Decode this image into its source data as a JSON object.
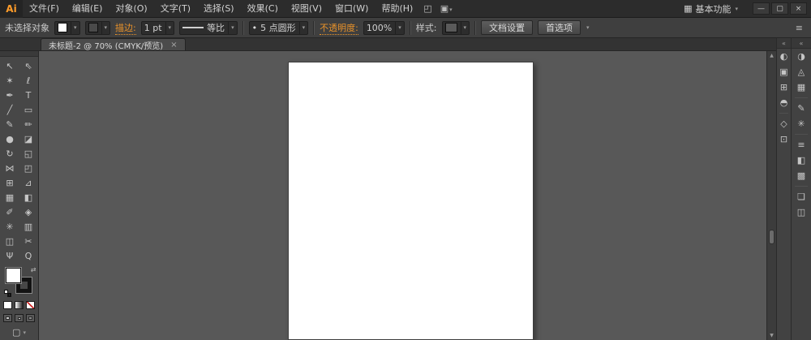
{
  "colors": {
    "accent_orange": "#e8922a",
    "logo_orange": "#ff9c2a",
    "canvas_gray": "#585858",
    "artboard_white": "#ffffff",
    "panel_gray": "#424242"
  },
  "menu_bar": {
    "logo": "Ai",
    "items": [
      "文件(F)",
      "编辑(E)",
      "对象(O)",
      "文字(T)",
      "选择(S)",
      "效果(C)",
      "视图(V)",
      "窗口(W)",
      "帮助(H)"
    ],
    "bridge_icon": "◰",
    "arrange_documents_icon": "▣",
    "arrange_documents_arrow": "▾",
    "workspace_icon": "▦",
    "workspace": "基本功能",
    "workspace_arrow": "▾",
    "minimize_glyph": "—",
    "restore_glyph": "▢",
    "close_glyph": "×"
  },
  "control_bar": {
    "selection_status": "未选择对象",
    "fill_arrow": "▾",
    "stroke_arrow": "▾",
    "stroke_label": "描边:",
    "stroke_weight": "1 pt",
    "weight_arrow": "▾",
    "profile_value": "等比",
    "profile_arrow": "▾",
    "brush_preview": "•",
    "brush_value": "5 点圆形",
    "brush_arrow": "▾",
    "opacity_label": "不透明度:",
    "opacity_value": "100%",
    "opacity_arrow": "▾",
    "style_label": "样式:",
    "style_arrow": "▾",
    "document_setup": "文档设置",
    "preferences": "首选项",
    "more_arrow": "▾",
    "panel_menu_icon": "≡"
  },
  "tab": {
    "title": "未标题-2 @ 70% (CMYK/预览)",
    "close_glyph": "×"
  },
  "toolbar": {
    "tools": [
      {
        "name": "selection-tool",
        "glyph": "↖"
      },
      {
        "name": "direct-selection-tool",
        "glyph": "⇖"
      },
      {
        "name": "magic-wand-tool",
        "glyph": "✶"
      },
      {
        "name": "lasso-tool",
        "glyph": "ℓ"
      },
      {
        "name": "pen-tool",
        "glyph": "✒"
      },
      {
        "name": "type-tool",
        "glyph": "T"
      },
      {
        "name": "line-segment-tool",
        "glyph": "╱"
      },
      {
        "name": "rectangle-tool",
        "glyph": "▭"
      },
      {
        "name": "paintbrush-tool",
        "glyph": "✎"
      },
      {
        "name": "pencil-tool",
        "glyph": "✏"
      },
      {
        "name": "blob-brush-tool",
        "glyph": "●"
      },
      {
        "name": "eraser-tool",
        "glyph": "◪"
      },
      {
        "name": "rotate-tool",
        "glyph": "↻"
      },
      {
        "name": "scale-tool",
        "glyph": "◱"
      },
      {
        "name": "width-tool",
        "glyph": "⋈"
      },
      {
        "name": "free-transform-tool",
        "glyph": "◰"
      },
      {
        "name": "shape-builder-tool",
        "glyph": "⊞"
      },
      {
        "name": "perspective-grid-tool",
        "glyph": "⊿"
      },
      {
        "name": "mesh-tool",
        "glyph": "▦"
      },
      {
        "name": "gradient-tool",
        "glyph": "◧"
      },
      {
        "name": "eyedropper-tool",
        "glyph": "✐"
      },
      {
        "name": "blend-tool",
        "glyph": "◈"
      },
      {
        "name": "symbol-sprayer-tool",
        "glyph": "✳"
      },
      {
        "name": "column-graph-tool",
        "glyph": "▥"
      },
      {
        "name": "artboard-tool",
        "glyph": "◫"
      },
      {
        "name": "slice-tool",
        "glyph": "✂"
      },
      {
        "name": "hand-tool",
        "glyph": "Ψ"
      },
      {
        "name": "zoom-tool",
        "glyph": "Q"
      }
    ],
    "swap_icon": "⇄",
    "screen_mode_icon": "▢",
    "screen_mode_arrow": "▾"
  },
  "scrollbar": {
    "up_glyph": "▲",
    "down_glyph": "▼"
  },
  "docks": {
    "collapse_icon": "«",
    "left_icons": [
      {
        "name": "appearance",
        "glyph": "◐"
      },
      {
        "name": "graphic-styles",
        "glyph": "▣"
      },
      {
        "name": "align",
        "glyph": "⊞"
      },
      {
        "name": "pathfinder",
        "glyph": "◓"
      },
      {
        "name": "transform",
        "glyph": "◇"
      },
      {
        "name": "navigator",
        "glyph": "⊡"
      }
    ],
    "right_icons": [
      {
        "name": "color",
        "glyph": "◑"
      },
      {
        "name": "color-guide",
        "glyph": "◬"
      },
      {
        "name": "swatches",
        "glyph": "▦"
      },
      {
        "name": "brushes",
        "glyph": "✎"
      },
      {
        "name": "symbols",
        "glyph": "✳"
      },
      {
        "name": "stroke",
        "glyph": "≡"
      },
      {
        "name": "gradient",
        "glyph": "◧"
      },
      {
        "name": "transparency",
        "glyph": "▩"
      },
      {
        "name": "layers",
        "glyph": "❏"
      },
      {
        "name": "artboards",
        "glyph": "◫"
      }
    ]
  }
}
